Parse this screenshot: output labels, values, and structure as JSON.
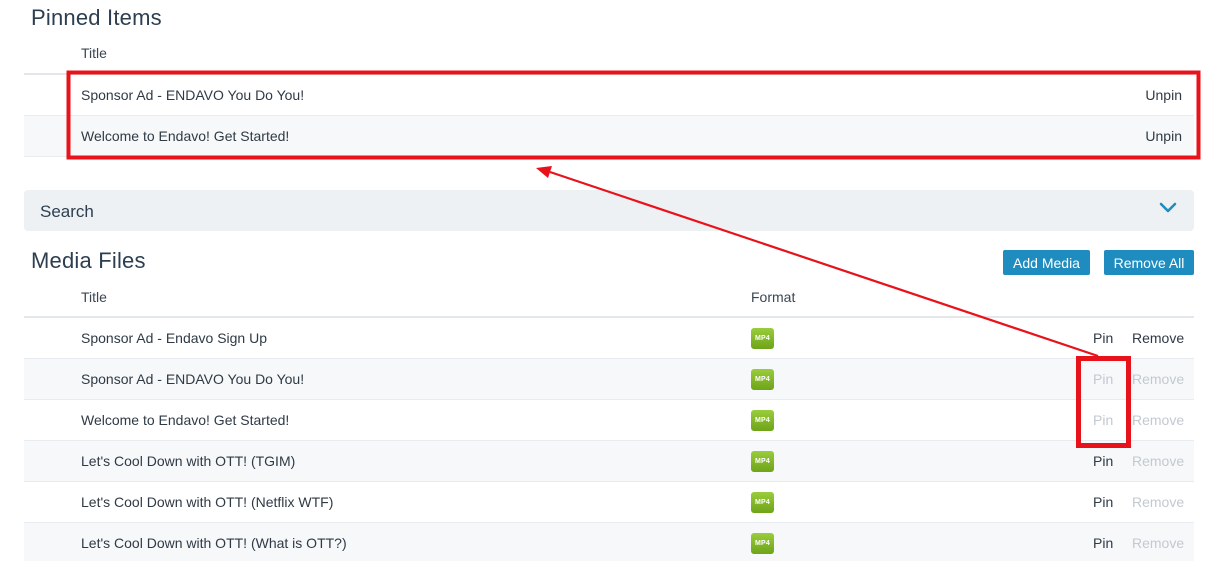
{
  "pinned": {
    "heading": "Pinned Items",
    "title_col": "Title",
    "items": [
      {
        "title": "Sponsor Ad - ENDAVO You Do You!",
        "action": "Unpin"
      },
      {
        "title": "Welcome to Endavo! Get Started!",
        "action": "Unpin"
      }
    ]
  },
  "search": {
    "label": "Search",
    "toggle_icon": "chevron-down-icon"
  },
  "media": {
    "heading": "Media Files",
    "add_label": "Add Media",
    "remove_all_label": "Remove All",
    "title_col": "Title",
    "format_col": "Format",
    "rows": [
      {
        "title": "Sponsor Ad - Endavo Sign Up",
        "format": "MP4",
        "pin": "Pin",
        "remove": "Remove",
        "pin_enabled": true,
        "remove_enabled": true
      },
      {
        "title": "Sponsor Ad - ENDAVO You Do You!",
        "format": "MP4",
        "pin": "Pin",
        "remove": "Remove",
        "pin_enabled": false,
        "remove_enabled": false
      },
      {
        "title": "Welcome to Endavo! Get Started!",
        "format": "MP4",
        "pin": "Pin",
        "remove": "Remove",
        "pin_enabled": false,
        "remove_enabled": false
      },
      {
        "title": "Let's Cool Down with OTT! (TGIM)",
        "format": "MP4",
        "pin": "Pin",
        "remove": "Remove",
        "pin_enabled": true,
        "remove_enabled": false
      },
      {
        "title": "Let's Cool Down with OTT! (Netflix WTF)",
        "format": "MP4",
        "pin": "Pin",
        "remove": "Remove",
        "pin_enabled": true,
        "remove_enabled": false
      },
      {
        "title": "Let's Cool Down with OTT! (What is OTT?)",
        "format": "MP4",
        "pin": "Pin",
        "remove": "Remove",
        "pin_enabled": true,
        "remove_enabled": false
      }
    ]
  },
  "colors": {
    "accent": "#1f8cc0",
    "highlight": "#e8121a",
    "format_badge": "#7cb82f",
    "disabled_text": "#c3c9d0"
  }
}
